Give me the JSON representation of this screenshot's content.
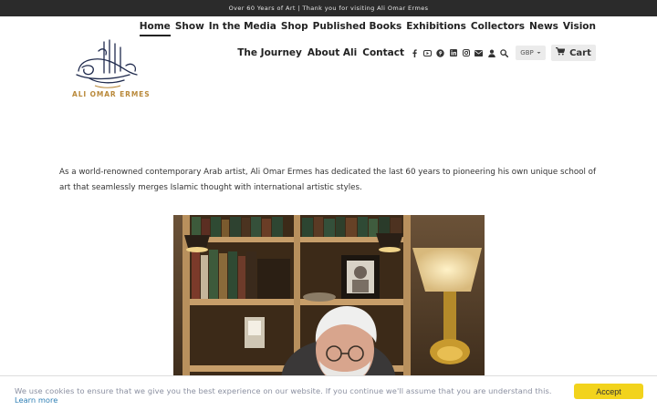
{
  "announcement": "Over 60 Years of Art | Thank you for visiting Ali Omar Ermes",
  "logo": {
    "name": "ALI OMAR ERMES"
  },
  "nav_main": [
    {
      "label": "Home",
      "active": true
    },
    {
      "label": "Show"
    },
    {
      "label": "In the Media"
    },
    {
      "label": "Shop"
    },
    {
      "label": "Published Books"
    },
    {
      "label": "Exhibitions"
    },
    {
      "label": "Collectors"
    },
    {
      "label": "News"
    },
    {
      "label": "Vision"
    }
  ],
  "nav_secondary": [
    {
      "label": "The Journey"
    },
    {
      "label": "About Ali"
    },
    {
      "label": "Contact"
    }
  ],
  "social_icons": [
    "facebook-icon",
    "youtube-icon",
    "pinterest-icon",
    "linkedin-icon",
    "instagram-icon",
    "email-icon",
    "account-icon",
    "search-icon"
  ],
  "currency": {
    "selected": "GBP"
  },
  "cart": {
    "label": "Cart"
  },
  "intro_text": "As a world-renowned contemporary Arab artist, Ali Omar Ermes has dedicated the last 60 years to pioneering his own unique school of art that seamlessly merges Islamic thought with international artistic styles.",
  "cookie": {
    "message": "We use cookies to ensure that we give you the best experience on our website. If you continue we'll assume that you are understand this.",
    "link": "Learn more",
    "button": "Accept"
  },
  "colors": {
    "accent": "#f2d31c",
    "logo_gold": "#b9893a",
    "logo_navy": "#1f2a4d",
    "announcement_bg": "#2b2b2b"
  }
}
